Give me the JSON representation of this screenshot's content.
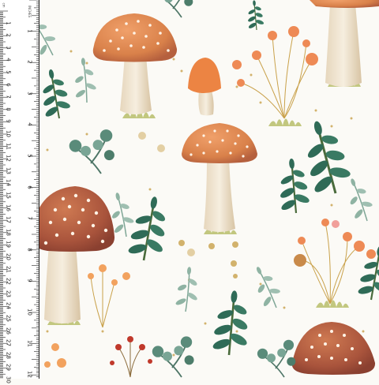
{
  "ruler": {
    "cm_unit": "cm",
    "inch_unit": "INCHES",
    "cm_labels": [
      "1",
      "2",
      "3",
      "4",
      "5",
      "6",
      "7",
      "8",
      "9",
      "10",
      "11",
      "12",
      "13",
      "14",
      "15",
      "16",
      "17",
      "18",
      "19",
      "20",
      "21",
      "22",
      "23",
      "24",
      "25",
      "26",
      "27",
      "28",
      "29",
      "30"
    ],
    "inch_labels": [
      "1",
      "2",
      "3",
      "4",
      "5",
      "6",
      "7",
      "8",
      "9",
      "10",
      "11",
      "12"
    ]
  },
  "colors": {
    "background": "#fbfaf6",
    "mushroom_cap": "#d9814a",
    "mushroom_cap_dark": "#a9543c",
    "mushroom_stem": "#efe3cf",
    "leaf_dark": "#2f6b57",
    "leaf_light": "#7fa696",
    "grass": "#b7bd6a",
    "berry": "#ee8a55",
    "red_berry": "#c0392b",
    "gold_dot": "#c9a14a"
  }
}
